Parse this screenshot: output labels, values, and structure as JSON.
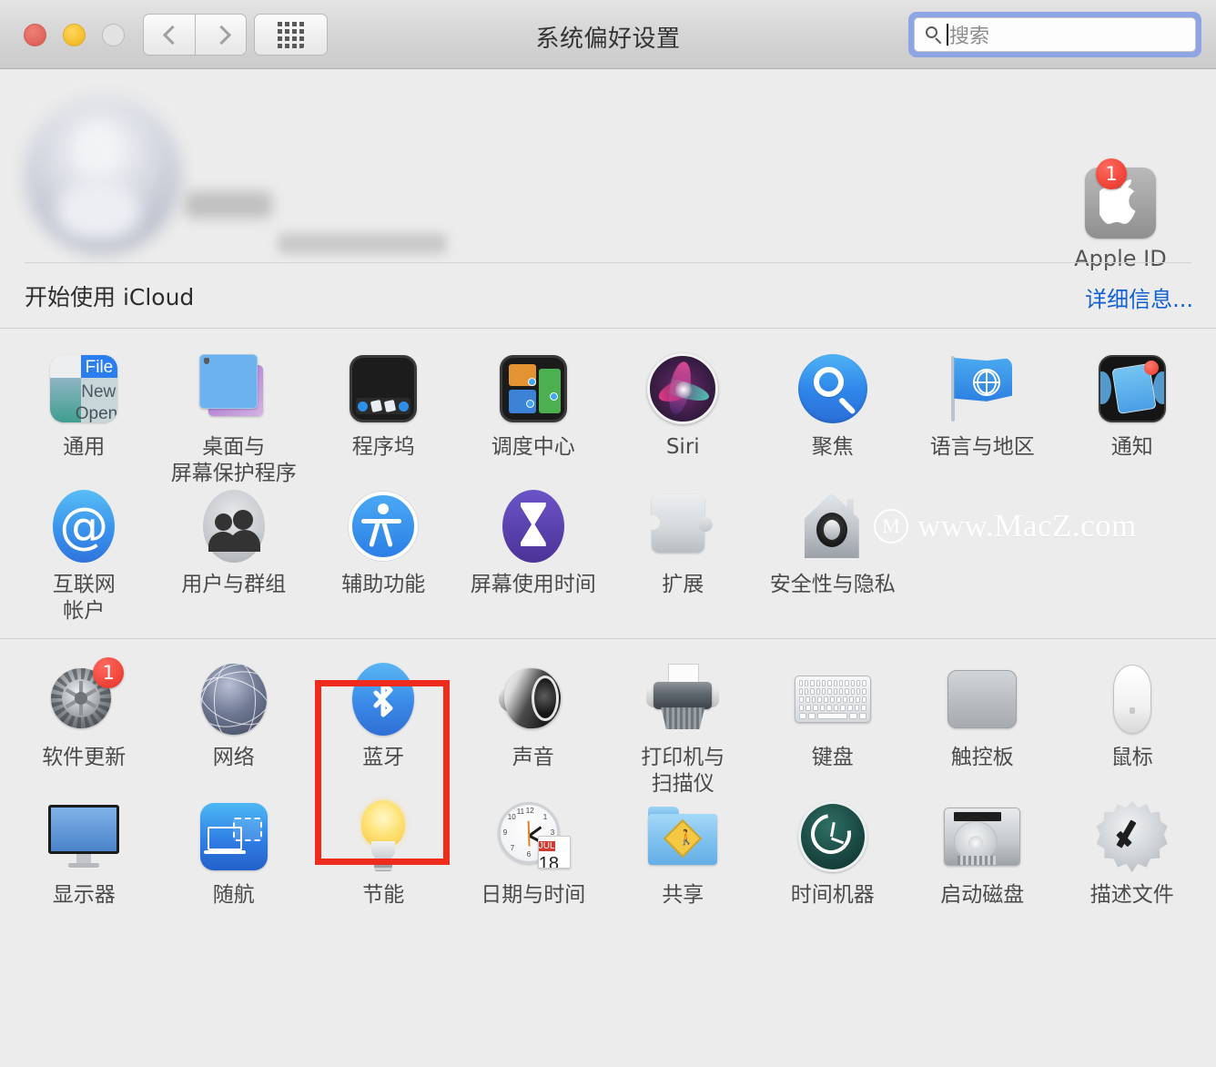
{
  "window": {
    "title": "系统偏好设置",
    "traffic_lights": [
      "close",
      "minimize",
      "zoom"
    ]
  },
  "toolbar": {
    "back_label": "‹",
    "forward_label": "›",
    "show_all_label": "show-all-grid",
    "search": {
      "placeholder": "搜索",
      "value": "",
      "focused": true,
      "focus_ring_color": "#8da6e3"
    }
  },
  "account": {
    "name_blurred": true,
    "email_blurred": true,
    "apple_id_label": "Apple ID",
    "apple_id_badge": "1",
    "icloud_prompt": "开始使用 iCloud",
    "details_link": "详细信息..."
  },
  "watermark": {
    "logo": "M",
    "text": "www.MacZ.com"
  },
  "highlight": {
    "target": "蓝牙",
    "color": "#ee2b1c"
  },
  "sections": [
    {
      "id": "section-primary",
      "items": [
        {
          "label": "通用",
          "icon": "general-icon"
        },
        {
          "label": "桌面与\n屏幕保护程序",
          "icon": "desktop-screensaver-icon"
        },
        {
          "label": "程序坞",
          "icon": "dock-icon"
        },
        {
          "label": "调度中心",
          "icon": "mission-control-icon"
        },
        {
          "label": "Siri",
          "icon": "siri-icon"
        },
        {
          "label": "聚焦",
          "icon": "spotlight-icon"
        },
        {
          "label": "语言与地区",
          "icon": "language-region-icon"
        },
        {
          "label": "通知",
          "icon": "notifications-icon"
        },
        {
          "label": "互联网\n帐户",
          "icon": "internet-accounts-icon"
        },
        {
          "label": "用户与群组",
          "icon": "users-groups-icon"
        },
        {
          "label": "辅助功能",
          "icon": "accessibility-icon"
        },
        {
          "label": "屏幕使用时间",
          "icon": "screen-time-icon"
        },
        {
          "label": "扩展",
          "icon": "extensions-icon"
        },
        {
          "label": "安全性与隐私",
          "icon": "security-privacy-icon"
        }
      ]
    },
    {
      "id": "section-hardware",
      "items": [
        {
          "label": "软件更新",
          "icon": "software-update-icon",
          "badge": "1"
        },
        {
          "label": "网络",
          "icon": "network-icon"
        },
        {
          "label": "蓝牙",
          "icon": "bluetooth-icon",
          "highlighted": true
        },
        {
          "label": "声音",
          "icon": "sound-icon"
        },
        {
          "label": "打印机与\n扫描仪",
          "icon": "printers-scanners-icon"
        },
        {
          "label": "键盘",
          "icon": "keyboard-icon"
        },
        {
          "label": "触控板",
          "icon": "trackpad-icon"
        },
        {
          "label": "鼠标",
          "icon": "mouse-icon"
        },
        {
          "label": "显示器",
          "icon": "displays-icon"
        },
        {
          "label": "随航",
          "icon": "sidecar-icon"
        },
        {
          "label": "节能",
          "icon": "energy-saver-icon"
        },
        {
          "label": "日期与时间",
          "icon": "date-time-icon",
          "clock": {
            "month": "JUL",
            "day": "18"
          }
        },
        {
          "label": "共享",
          "icon": "sharing-icon"
        },
        {
          "label": "时间机器",
          "icon": "time-machine-icon"
        },
        {
          "label": "启动磁盘",
          "icon": "startup-disk-icon"
        },
        {
          "label": "描述文件",
          "icon": "profiles-icon"
        }
      ]
    }
  ]
}
